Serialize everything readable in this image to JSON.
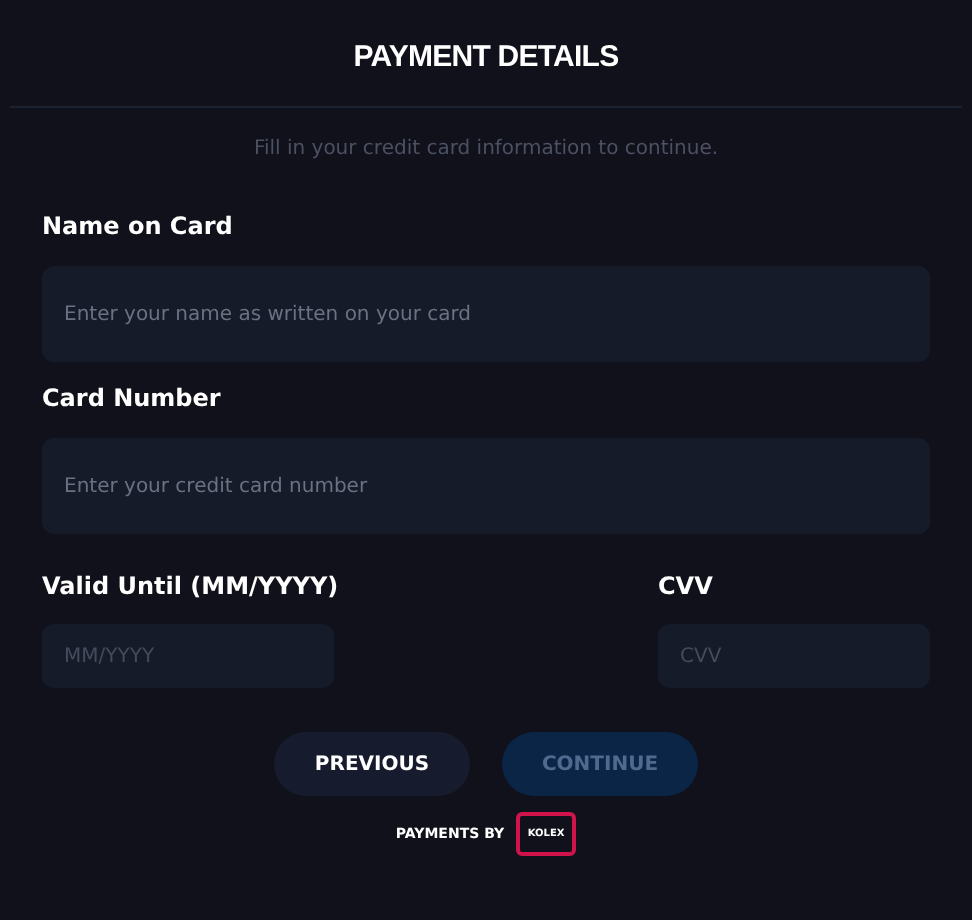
{
  "title": "PAYMENT DETAILS",
  "subtitle": "Fill in your credit card information to continue.",
  "fields": [
    {
      "label": "Name on Card",
      "placeholder": "Enter your name as written on your card"
    },
    {
      "label": "Card Number",
      "placeholder": "Enter your credit card number"
    }
  ],
  "row_fields": [
    {
      "label": "Valid Until (MM/YYYY)",
      "placeholder": "MM/YYYY"
    },
    {
      "label": "CVV",
      "placeholder": "CVV"
    }
  ],
  "buttons": [
    {
      "label": "PREVIOUS",
      "disabled": false
    },
    {
      "label": "CONTINUE",
      "disabled": true
    }
  ],
  "footer": {
    "text": "PAYMENTS BY",
    "logo_text": "KOLEX"
  }
}
